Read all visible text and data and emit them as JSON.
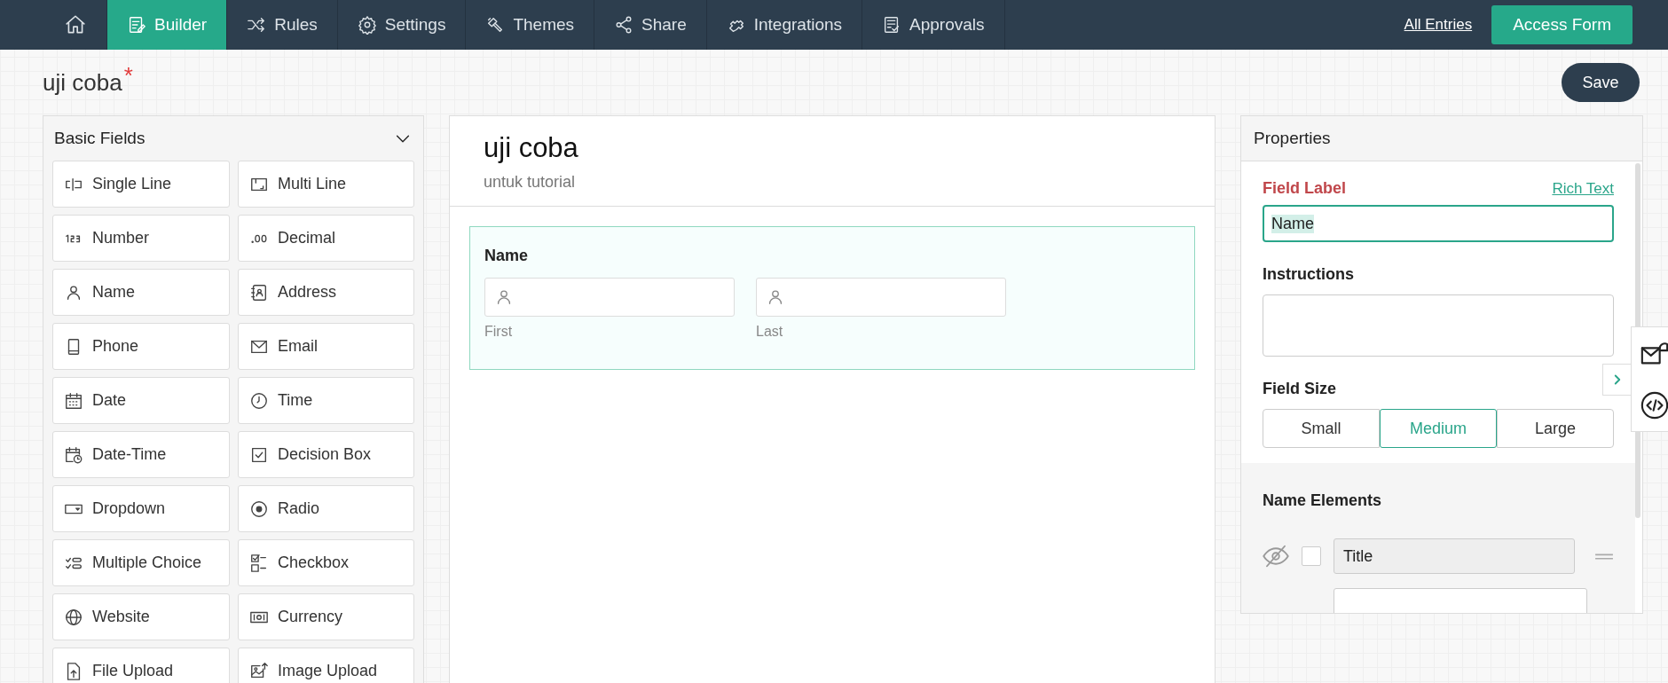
{
  "nav": {
    "items": [
      {
        "kind": "home",
        "selected": false
      },
      {
        "kind": "builder",
        "label": "Builder",
        "selected": true
      },
      {
        "kind": "rules",
        "label": "Rules",
        "selected": false
      },
      {
        "kind": "settings",
        "label": "Settings",
        "selected": false
      },
      {
        "kind": "themes",
        "label": "Themes",
        "selected": false
      },
      {
        "kind": "share",
        "label": "Share",
        "selected": false
      },
      {
        "kind": "integrations",
        "label": "Integrations",
        "selected": false
      },
      {
        "kind": "approvals",
        "label": "Approvals",
        "selected": false
      }
    ],
    "link": "All Entries",
    "button": "Access Form"
  },
  "form_title": {
    "text": "uji coba",
    "asterisk": "*"
  },
  "save_button": "Save",
  "fields_panel": {
    "title": "Basic Fields",
    "items": [
      {
        "kind": "single",
        "label": "Single Line"
      },
      {
        "kind": "multi",
        "label": "Multi Line"
      },
      {
        "kind": "number",
        "label": "Number"
      },
      {
        "kind": "decimal",
        "label": "Decimal"
      },
      {
        "kind": "name",
        "label": "Name"
      },
      {
        "kind": "address",
        "label": "Address"
      },
      {
        "kind": "phone",
        "label": "Phone"
      },
      {
        "kind": "email",
        "label": "Email"
      },
      {
        "kind": "date",
        "label": "Date"
      },
      {
        "kind": "time",
        "label": "Time"
      },
      {
        "kind": "datetime",
        "label": "Date-Time"
      },
      {
        "kind": "decision",
        "label": "Decision Box"
      },
      {
        "kind": "dropdown",
        "label": "Dropdown"
      },
      {
        "kind": "radio",
        "label": "Radio"
      },
      {
        "kind": "multiple",
        "label": "Multiple Choice"
      },
      {
        "kind": "checkbox",
        "label": "Checkbox"
      },
      {
        "kind": "website",
        "label": "Website"
      },
      {
        "kind": "currency",
        "label": "Currency"
      },
      {
        "kind": "file",
        "label": "File Upload"
      },
      {
        "kind": "image",
        "label": "Image Upload"
      }
    ]
  },
  "canvas": {
    "title": "uji coba",
    "subtitle": "untuk tutorial",
    "field": {
      "label": "Name",
      "parts": [
        {
          "sublabel": "First"
        },
        {
          "sublabel": "Last"
        }
      ]
    }
  },
  "properties": {
    "title": "Properties",
    "field_label": "Field Label",
    "rich_text": "Rich Text",
    "label_value": "Name",
    "instructions": "Instructions",
    "field_size": "Field Size",
    "sizes": [
      {
        "label": "Small",
        "selected": false
      },
      {
        "label": "Medium",
        "selected": true
      },
      {
        "label": "Large",
        "selected": false
      }
    ],
    "name_elements": {
      "title": "Name Elements",
      "rows": [
        {
          "label": "Title",
          "visible": false,
          "checked": false
        }
      ]
    }
  }
}
